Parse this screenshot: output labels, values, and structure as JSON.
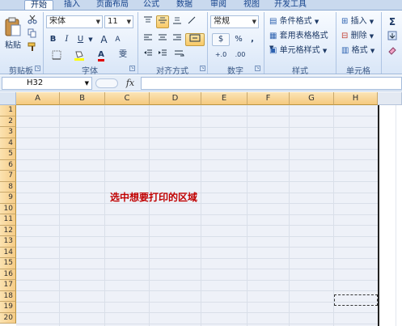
{
  "tabs": [
    "开始",
    "插入",
    "页面布局",
    "公式",
    "数据",
    "审阅",
    "视图",
    "开发工具"
  ],
  "clipboard": {
    "paste_label": "粘贴",
    "group_label": "剪贴板"
  },
  "font": {
    "name": "宋体",
    "size": "11",
    "bold": "B",
    "italic": "I",
    "underline": "U",
    "grow": "A",
    "shrink": "A",
    "font_color_letter": "A",
    "phonetic": "雯",
    "group_label": "字体"
  },
  "alignment": {
    "group_label": "对齐方式"
  },
  "number": {
    "format": "常规",
    "currency": "$",
    "percent": "%",
    "comma": ",",
    "inc_decimal": "+.0",
    "dec_decimal": ".00",
    "group_label": "数字"
  },
  "styles": {
    "conditional": "条件格式",
    "table": "套用表格格式",
    "cell": "单元格样式",
    "group_label": "样式"
  },
  "cells": {
    "insert": "插入",
    "delete": "删除",
    "format": "格式",
    "group_label": "单元格"
  },
  "editing": {
    "sum": "Σ"
  },
  "name_box": "H32",
  "fx_label": "fx",
  "columns": [
    "A",
    "B",
    "C",
    "D",
    "E",
    "F",
    "G",
    "H"
  ],
  "rows": [
    "1",
    "2",
    "3",
    "4",
    "5",
    "6",
    "7",
    "8",
    "9",
    "10",
    "11",
    "12",
    "13",
    "14",
    "15",
    "16",
    "17",
    "18",
    "19",
    "20"
  ],
  "sheet_note": "选中想要打印的区域",
  "colors": {
    "note": "#c00000",
    "header": "#f5c97f",
    "ribbon": "#dfe8f6"
  }
}
